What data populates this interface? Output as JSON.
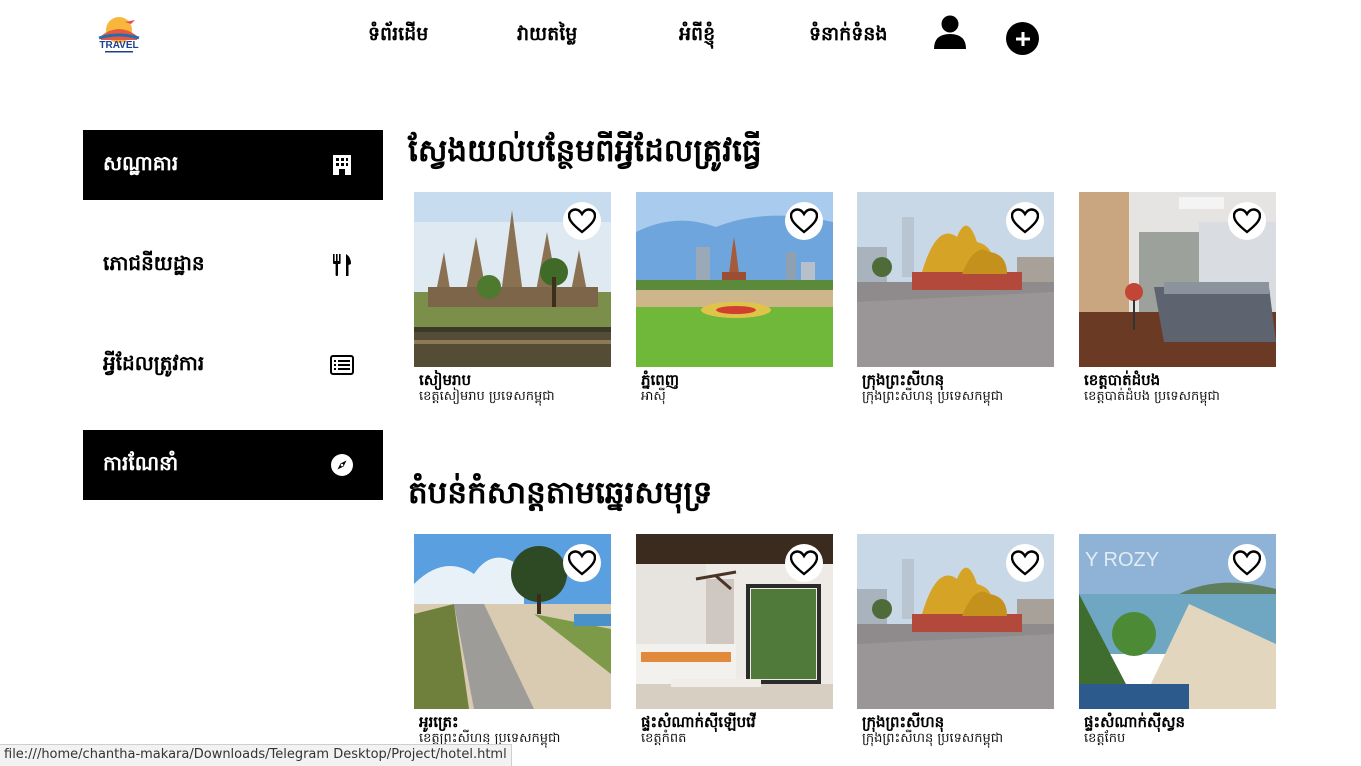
{
  "logo": {
    "text": "TRAVEL"
  },
  "nav": {
    "home": "ទំព័រដើម",
    "rating": "វាយតម្លៃ",
    "about": "អំពីខ្ញុំ",
    "contact": "ទំនាក់ទំនង"
  },
  "sidebar": {
    "items": [
      {
        "label": "សណ្ឋាគារ",
        "icon": "building-icon"
      },
      {
        "label": "ភោជនីយដ្ឋាន",
        "icon": "utensils-icon"
      },
      {
        "label": "អ្វីដែលត្រូវការ",
        "icon": "list-icon"
      },
      {
        "label": "ការណែនាំ",
        "icon": "compass-icon"
      }
    ]
  },
  "sections": [
    {
      "title": "ស្វែងយល់បន្ថែមពីអ្វីដែលត្រូវធ្វើ",
      "cards": [
        {
          "title": "សៀមរាប",
          "subtitle": "ខេត្តសៀមរាប ប្រទេសកម្ពុជា",
          "image": "angkor-wat"
        },
        {
          "title": "ភ្នំពេញ",
          "subtitle": "អាស៊ី",
          "image": "independence-monument"
        },
        {
          "title": "ក្រុងព្រះសីហនុ",
          "subtitle": "ក្រុងព្រះសីហនុ ប្រទេសកម្ពុជា",
          "image": "golden-lions"
        },
        {
          "title": "ខេត្តបាត់ដំបង",
          "subtitle": "ខេត្តបាត់ដំបង ប្រទេសកម្ពុជា",
          "image": "bedroom"
        }
      ]
    },
    {
      "title": "តំបន់កំសាន្តតាមឆ្នេរសមុទ្រ",
      "cards": [
        {
          "title": "អូរត្រេះ",
          "subtitle": "ខេត្តព្រះសីហនុ ប្រទេសកម្ពុជា",
          "image": "beach-path"
        },
        {
          "title": "ផ្ទះសំណាក់ស៊ីឡើបវើ",
          "subtitle": "ខេត្តកំពត",
          "image": "hotel-room"
        },
        {
          "title": "ក្រុងព្រះសីហនុ",
          "subtitle": "ក្រុងព្រះសីហនុ ប្រទេសកម្ពុជា",
          "image": "golden-lions"
        },
        {
          "title": "ផ្ទះសំណាក់ស៊ីស្វន",
          "subtitle": "ខេត្តកែប",
          "image": "kep-beach",
          "watermark": "Y ROZY"
        }
      ]
    }
  ],
  "status_bar": {
    "url": "file:///home/chantha-makara/Downloads/Telegram Desktop/Project/hotel.html"
  },
  "colors": {
    "dark": "#000000",
    "background": "#ffffff"
  }
}
